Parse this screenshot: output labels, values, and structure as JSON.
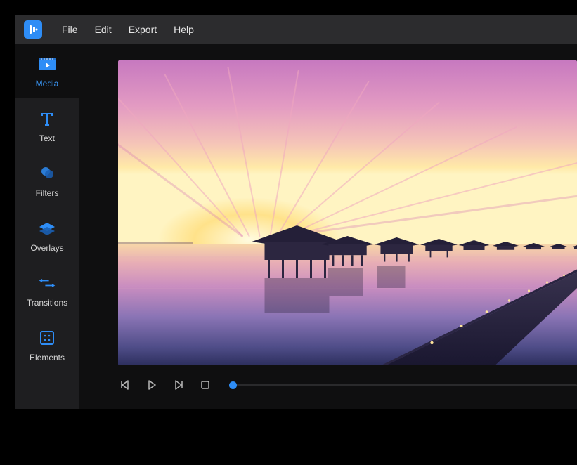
{
  "menubar": {
    "items": [
      {
        "label": "File"
      },
      {
        "label": "Edit"
      },
      {
        "label": "Export"
      },
      {
        "label": "Help"
      }
    ]
  },
  "sidebar": {
    "items": [
      {
        "label": "Media",
        "icon": "media-icon",
        "active": true
      },
      {
        "label": "Text",
        "icon": "text-icon",
        "active": false
      },
      {
        "label": "Filters",
        "icon": "filters-icon",
        "active": false
      },
      {
        "label": "Overlays",
        "icon": "overlays-icon",
        "active": false
      },
      {
        "label": "Transitions",
        "icon": "transitions-icon",
        "active": false
      },
      {
        "label": "Elements",
        "icon": "elements-icon",
        "active": false
      }
    ]
  },
  "transport": {
    "playhead_position": 0
  },
  "colors": {
    "accent": "#2e8df6",
    "bg_dark": "#0f0f10",
    "bg_panel": "#1e1e20",
    "bg_menubar": "#2c2c2e"
  }
}
